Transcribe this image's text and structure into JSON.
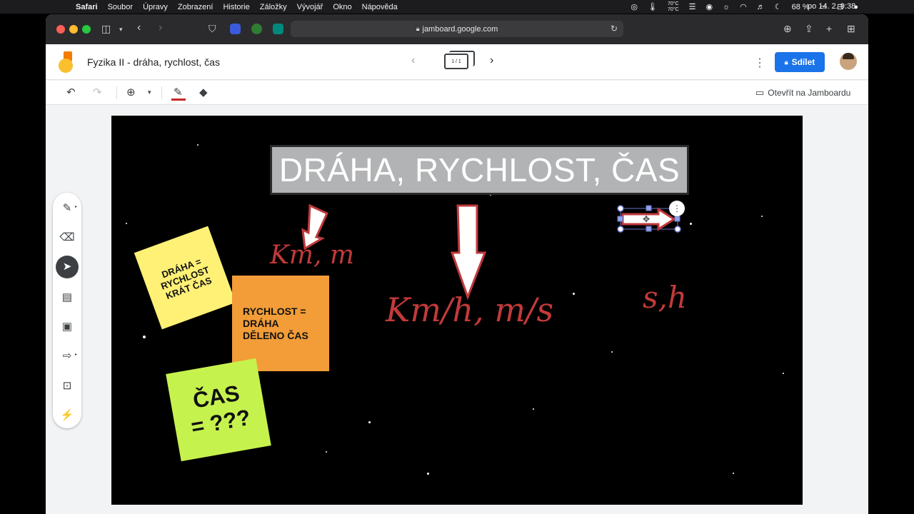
{
  "menubar": {
    "apple": "",
    "items": [
      "Safari",
      "Soubor",
      "Úpravy",
      "Zobrazení",
      "Historie",
      "Záložky",
      "Vývojář",
      "Okno",
      "Nápověda"
    ],
    "temp_top": "70°C",
    "temp_bottom": "70°C",
    "battery": "68 %",
    "clock": "po 14. 2.  9:38"
  },
  "browser": {
    "url": "jamboard.google.com"
  },
  "jamboard": {
    "title": "Fyzika II - dráha, rychlost, čas",
    "frame_counter": "1 / 1",
    "share_label": "Sdílet",
    "open_label": "Otevřít na Jamboardu",
    "pen_color": "#c62828",
    "accent": "#1a73e8"
  },
  "board": {
    "title": "DRÁHA, RYCHLOST, ČAS",
    "notes": {
      "yellow": [
        "DRÁHA =",
        "RYCHLOST",
        "KRÁT ČAS"
      ],
      "orange": [
        "RYCHLOST =",
        "DRÁHA",
        "DĚLENO ČAS"
      ],
      "green": [
        "ČAS",
        "= ???"
      ]
    },
    "hand_km_m": "Km, m",
    "hand_kmh_ms": "Km/h,  m/s",
    "hand_s_h": "s,h"
  }
}
